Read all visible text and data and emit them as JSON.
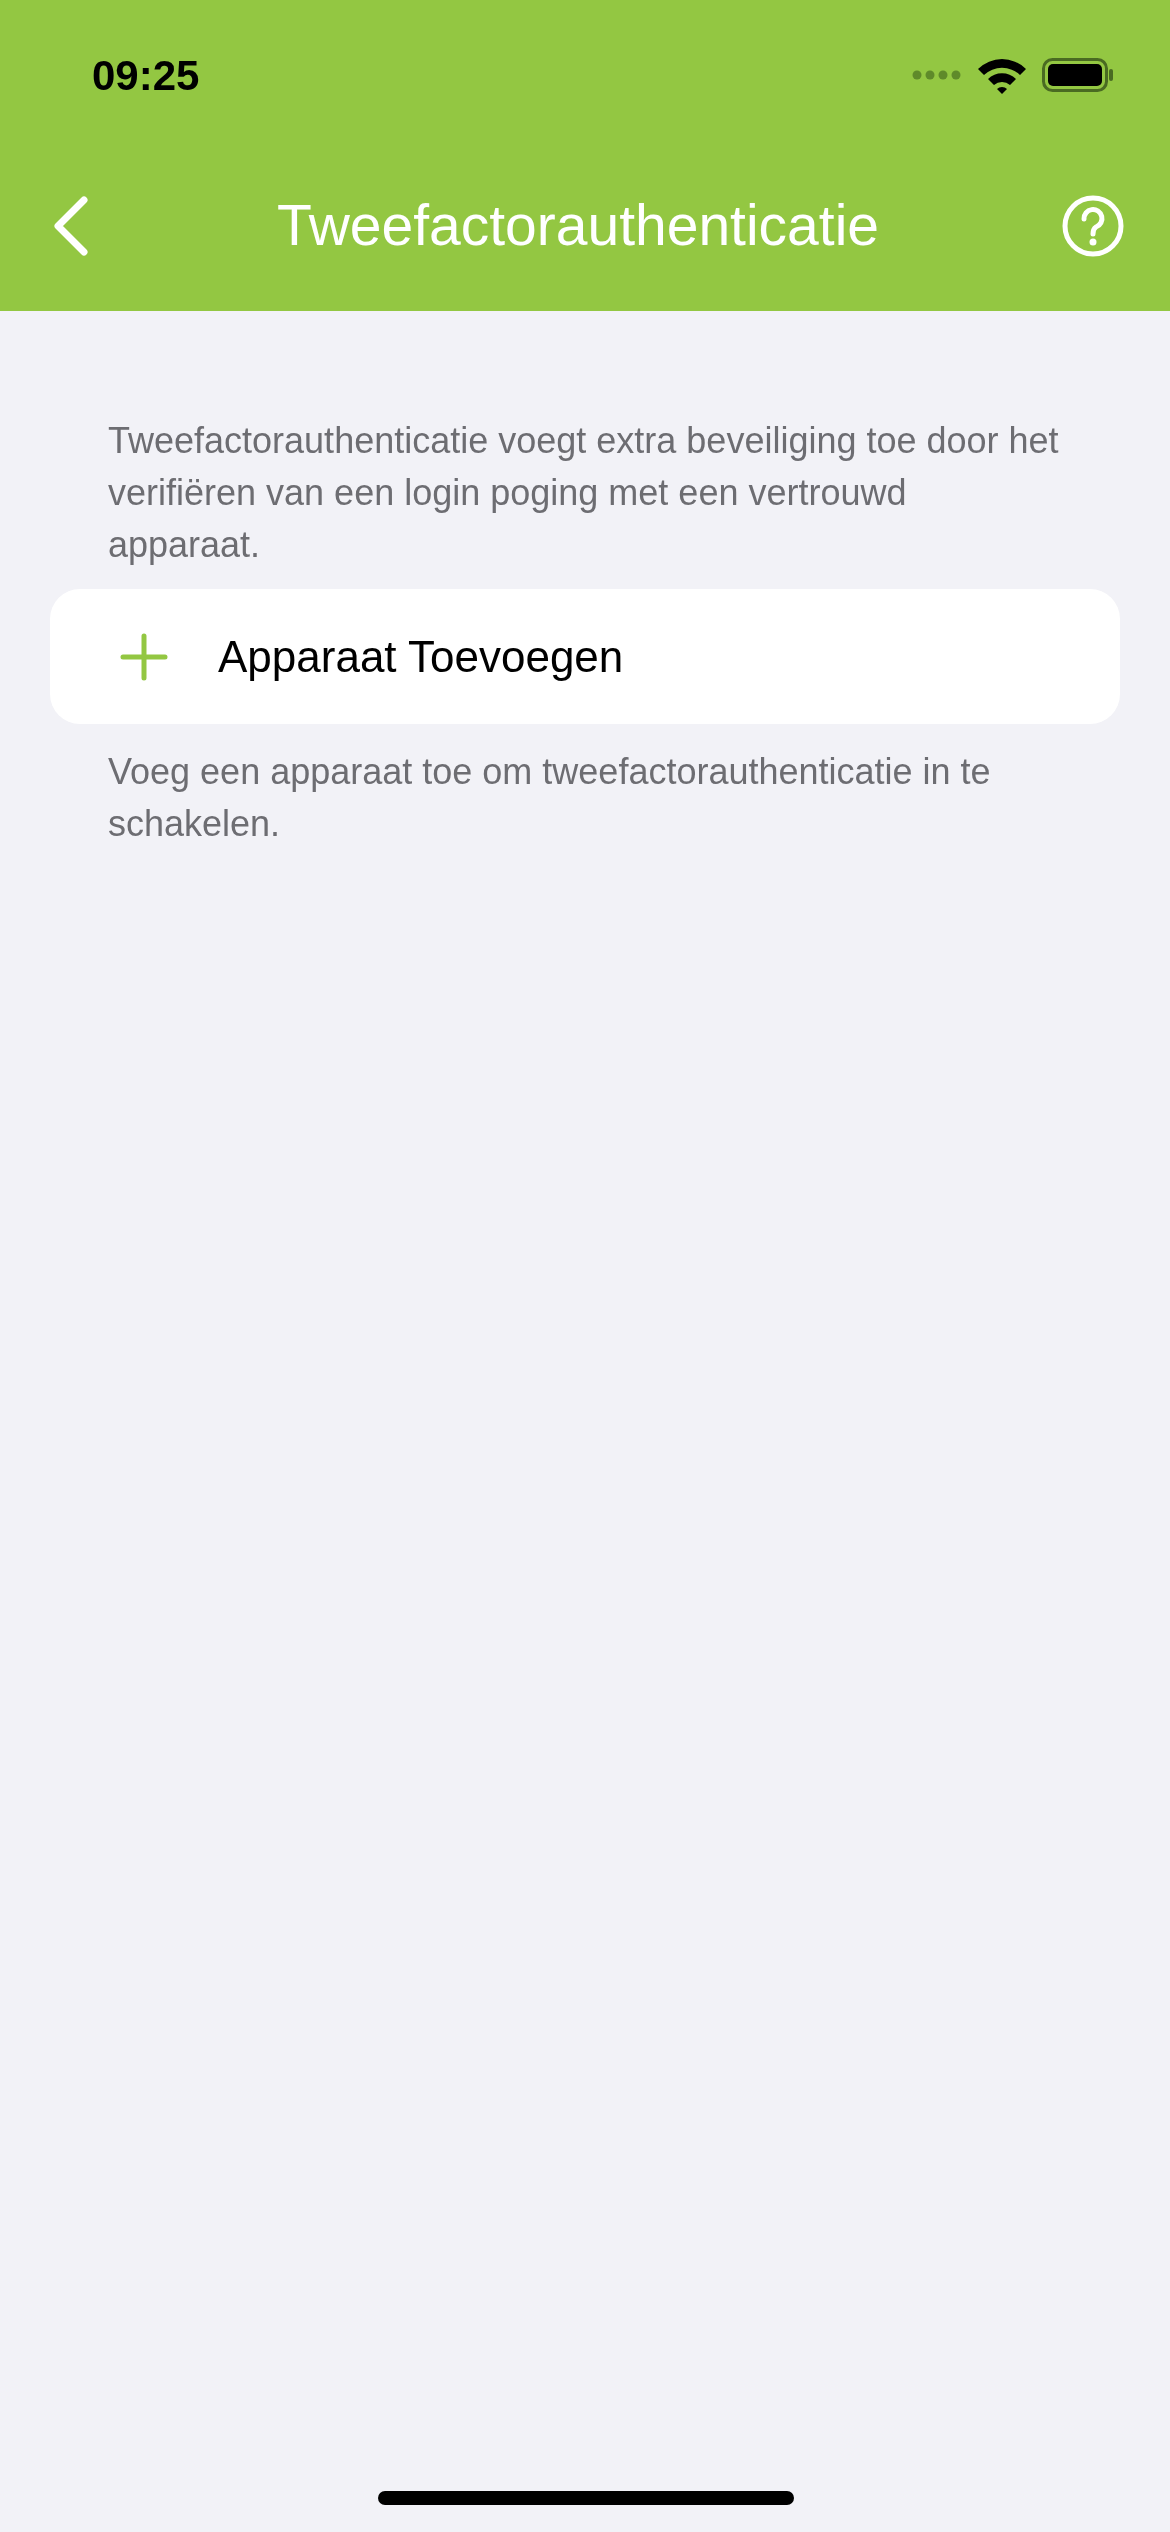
{
  "status_bar": {
    "time": "09:25"
  },
  "nav_bar": {
    "title": "Tweefactorauthenticatie"
  },
  "description": "Tweefactorauthenticatie voegt extra beveiliging toe door het verifiëren van een login poging met een vertrouwd apparaat.",
  "add_device_button": {
    "label": "Apparaat Toevoegen"
  },
  "footer_note": "Voeg een apparaat toe om tweefactorauthenticatie in te schakelen."
}
